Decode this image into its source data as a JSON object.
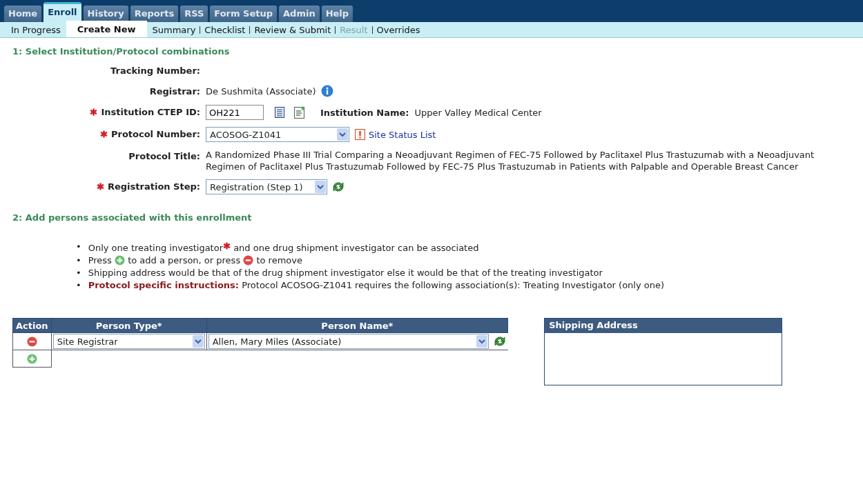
{
  "tabs": [
    {
      "label": "Home",
      "selected": false
    },
    {
      "label": "Enroll",
      "selected": true
    },
    {
      "label": "History",
      "selected": false
    },
    {
      "label": "Reports",
      "selected": false
    },
    {
      "label": "RSS",
      "selected": false
    },
    {
      "label": "Form Setup",
      "selected": false
    },
    {
      "label": "Admin",
      "selected": false
    },
    {
      "label": "Help",
      "selected": false
    }
  ],
  "subnav": [
    {
      "label": "In Progress",
      "selected": false,
      "disabled": false
    },
    {
      "label": "Create New",
      "selected": true,
      "disabled": false
    },
    {
      "label": "Summary",
      "selected": false,
      "disabled": false
    },
    {
      "label": "Checklist",
      "selected": false,
      "disabled": false
    },
    {
      "label": "Review & Submit",
      "selected": false,
      "disabled": false
    },
    {
      "label": "Result",
      "selected": false,
      "disabled": true
    },
    {
      "label": "Overrides",
      "selected": false,
      "disabled": false
    }
  ],
  "section1": {
    "title": "1: Select Institution/Protocol combinations",
    "fields": [
      {
        "kind": "text",
        "label": "Tracking Number:",
        "required": false
      },
      {
        "kind": "info",
        "label": "Registrar:",
        "required": false,
        "value": "De Sushmita (Associate)"
      },
      {
        "kind": "institution",
        "label": "Institution CTEP ID:",
        "required": true,
        "value": "OH221",
        "name_label": "Institution Name:",
        "name_value": "Upper Valley Medical Center"
      },
      {
        "kind": "protocol",
        "label": "Protocol Number:",
        "required": true,
        "value": "ACOSOG-Z1041",
        "link": "Site Status List"
      },
      {
        "kind": "text",
        "label": "Protocol Title:",
        "required": false,
        "value": "A Randomized Phase III Trial Comparing a Neoadjuvant Regimen of FEC-75 Followed by Paclitaxel Plus Trastuzumab with a Neoadjuvant Regimen of Paclitaxel Plus Trastuzumab Followed by FEC-75 Plus Trastuzumab in Patients with Palpable and Operable Breast Cancer"
      },
      {
        "kind": "step",
        "label": "Registration Step:",
        "required": true,
        "value": "Registration (Step 1)"
      }
    ]
  },
  "section2": {
    "title": "2: Add persons associated with this enrollment",
    "bullets": [
      {
        "marker": "•",
        "segments": [
          {
            "kind": "text",
            "text": "Only one treating investigator"
          },
          {
            "kind": "required"
          },
          {
            "kind": "text",
            "text": " and one drug shipment investigator can be associated"
          }
        ]
      },
      {
        "marker": "•",
        "segments": [
          {
            "kind": "text",
            "text": "Press "
          },
          {
            "kind": "add"
          },
          {
            "kind": "text",
            "text": " to add a person, or press "
          },
          {
            "kind": "remove"
          },
          {
            "kind": "text",
            "text": " to remove"
          }
        ]
      },
      {
        "marker": "•",
        "segments": [
          {
            "kind": "text",
            "text": "Shipping address would be that of the drug shipment investigator else it would be that of the treating investigator"
          }
        ]
      },
      {
        "marker": "•",
        "segments": [
          {
            "kind": "label",
            "text": "Protocol specific instructions:"
          },
          {
            "kind": "text",
            "text": "  Protocol ACOSOG-Z1041 requires the following association(s): Treating Investigator (only one)"
          }
        ]
      }
    ],
    "table": {
      "columns": [
        "Action",
        "Person Type*",
        "Person Name*"
      ],
      "rows": [
        {
          "kind": "person",
          "person_type": "Site Registrar",
          "person_name": "Allen, Mary Miles (Associate)"
        },
        {
          "kind": "add"
        }
      ]
    },
    "shipping": {
      "title": "Shipping Address"
    }
  }
}
